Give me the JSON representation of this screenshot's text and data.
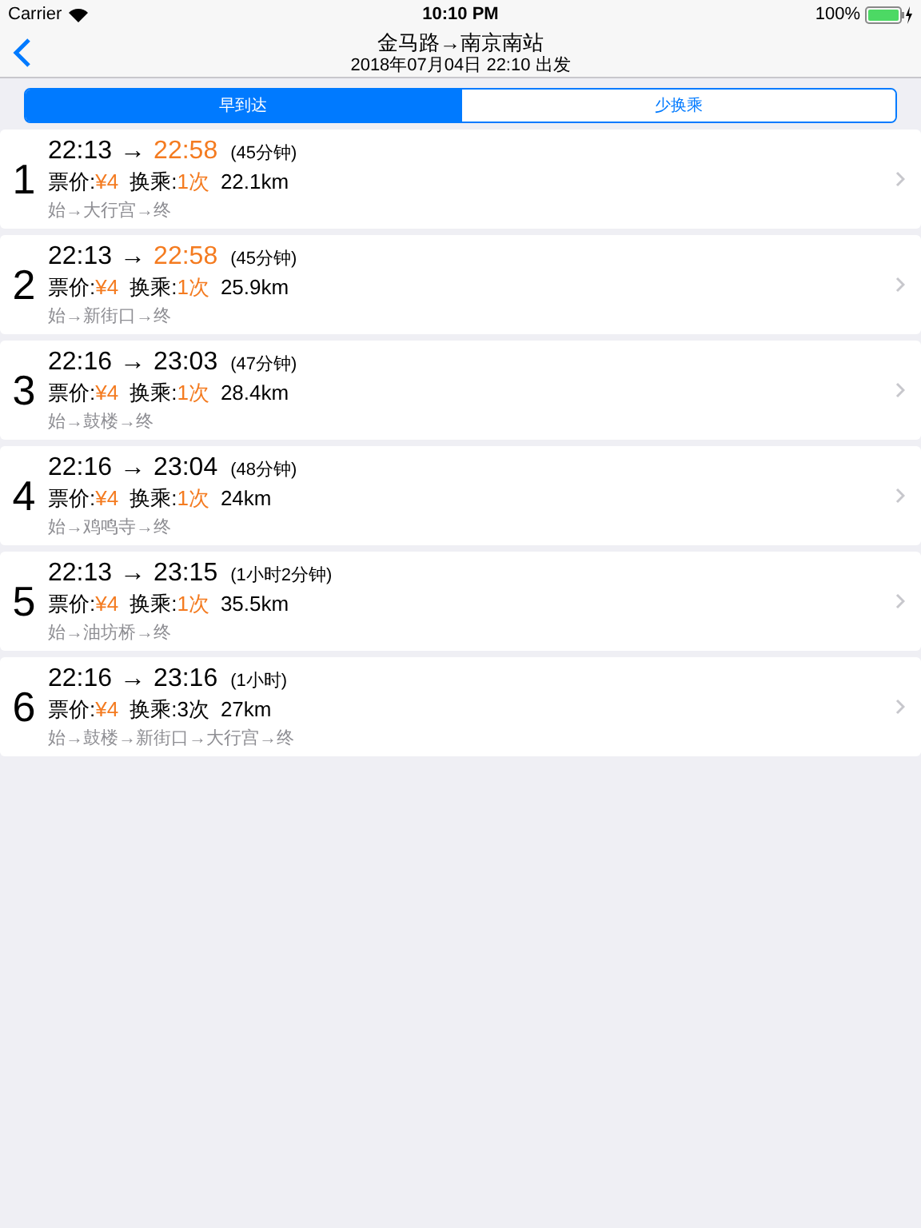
{
  "status_bar": {
    "carrier": "Carrier",
    "time": "10:10 PM",
    "battery": "100%"
  },
  "nav": {
    "title": "金马路→南京南站",
    "subtitle": "2018年07月04日 22:10 出发"
  },
  "tabs": [
    {
      "label": "早到达",
      "selected": true
    },
    {
      "label": "少换乘",
      "selected": false
    }
  ],
  "routes": [
    {
      "index": "1",
      "depart": "22:13",
      "arrow": "→",
      "arrive": "22:58",
      "arrive_highlighted": true,
      "duration": "(45分钟)",
      "fare_label": "票价:",
      "fare": "¥4",
      "transfer_label": "换乘:",
      "transfers": "1次",
      "transfers_highlighted": true,
      "distance": "22.1km",
      "path": "始→大行宫→终"
    },
    {
      "index": "2",
      "depart": "22:13",
      "arrow": "→",
      "arrive": "22:58",
      "arrive_highlighted": true,
      "duration": "(45分钟)",
      "fare_label": "票价:",
      "fare": "¥4",
      "transfer_label": "换乘:",
      "transfers": "1次",
      "transfers_highlighted": true,
      "distance": "25.9km",
      "path": "始→新街口→终"
    },
    {
      "index": "3",
      "depart": "22:16",
      "arrow": "→",
      "arrive": "23:03",
      "arrive_highlighted": false,
      "duration": "(47分钟)",
      "fare_label": "票价:",
      "fare": "¥4",
      "transfer_label": "换乘:",
      "transfers": "1次",
      "transfers_highlighted": true,
      "distance": "28.4km",
      "path": "始→鼓楼→终"
    },
    {
      "index": "4",
      "depart": "22:16",
      "arrow": "→",
      "arrive": "23:04",
      "arrive_highlighted": false,
      "duration": "(48分钟)",
      "fare_label": "票价:",
      "fare": "¥4",
      "transfer_label": "换乘:",
      "transfers": "1次",
      "transfers_highlighted": true,
      "distance": "24km",
      "path": "始→鸡鸣寺→终"
    },
    {
      "index": "5",
      "depart": "22:13",
      "arrow": "→",
      "arrive": "23:15",
      "arrive_highlighted": false,
      "duration": "(1小时2分钟)",
      "fare_label": "票价:",
      "fare": "¥4",
      "transfer_label": "换乘:",
      "transfers": "1次",
      "transfers_highlighted": true,
      "distance": "35.5km",
      "path": "始→油坊桥→终"
    },
    {
      "index": "6",
      "depart": "22:16",
      "arrow": "→",
      "arrive": "23:16",
      "arrive_highlighted": false,
      "duration": "(1小时)",
      "fare_label": "票价:",
      "fare": "¥4",
      "transfer_label": "换乘:",
      "transfers": "3次",
      "transfers_highlighted": false,
      "distance": "27km",
      "path": "始→鼓楼→新街口→大行宫→终"
    }
  ]
}
